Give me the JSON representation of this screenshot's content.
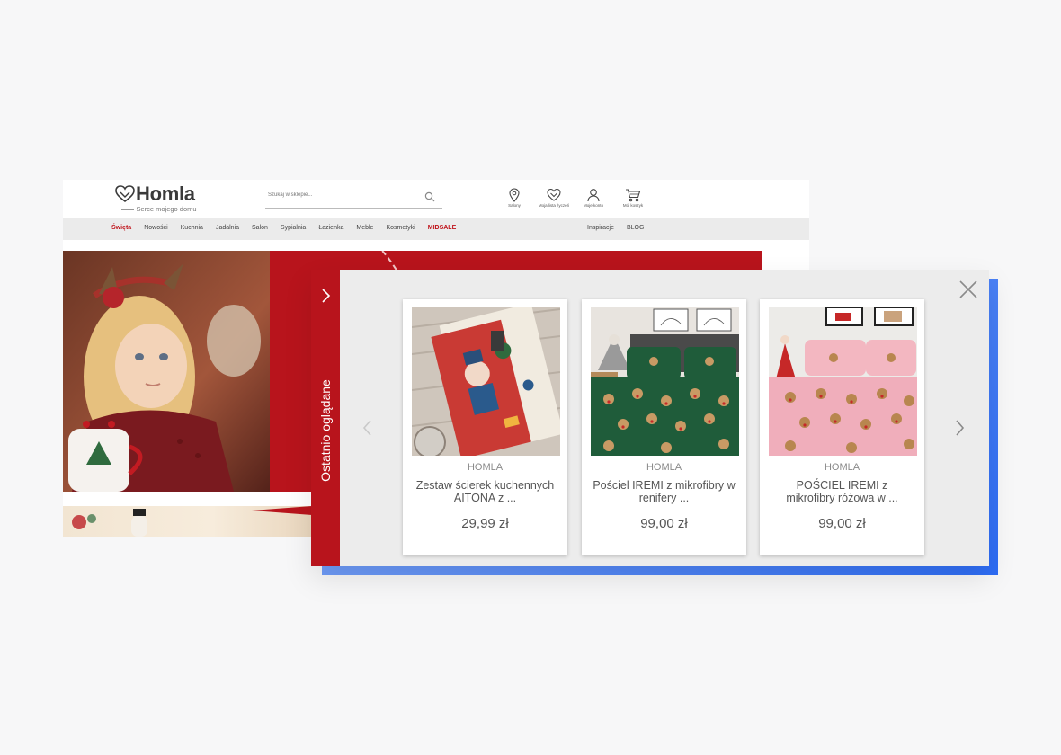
{
  "store": {
    "logo_text": "Homla",
    "logo_tagline": "Serce mojego domu",
    "search_placeholder": "Szukaj w sklepie...",
    "header_icons": [
      "Salony",
      "Moja lista życzeń",
      "Moje konto",
      "Mój koszyk"
    ],
    "nav_items": [
      "Święta",
      "Nowości",
      "Kuchnia",
      "Jadalnia",
      "Salon",
      "Sypialnia",
      "Łazienka",
      "Meble",
      "Kosmetyki",
      "MIDSALE"
    ],
    "nav_right": [
      "Inspiracje",
      "BLOG"
    ],
    "colors": {
      "brand_red": "#c0151c",
      "nav_bg": "#ebebeb"
    }
  },
  "widget": {
    "side_label": "Ostatnio oglądane",
    "products": [
      {
        "brand": "HOMLA",
        "title": "Zestaw ścierek kuchennych AITONA z ...",
        "price": "29,99 zł"
      },
      {
        "brand": "HOMLA",
        "title": "Pościel IREMI z mikrofibry w renifery ...",
        "price": "99,00 zł"
      },
      {
        "brand": "HOMLA",
        "title": "POŚCIEL IREMI z mikrofibry różowa w ...",
        "price": "99,00 zł"
      }
    ],
    "colors": {
      "tab_red": "#b8141c",
      "accent_blue": "#2d6cf5"
    }
  }
}
